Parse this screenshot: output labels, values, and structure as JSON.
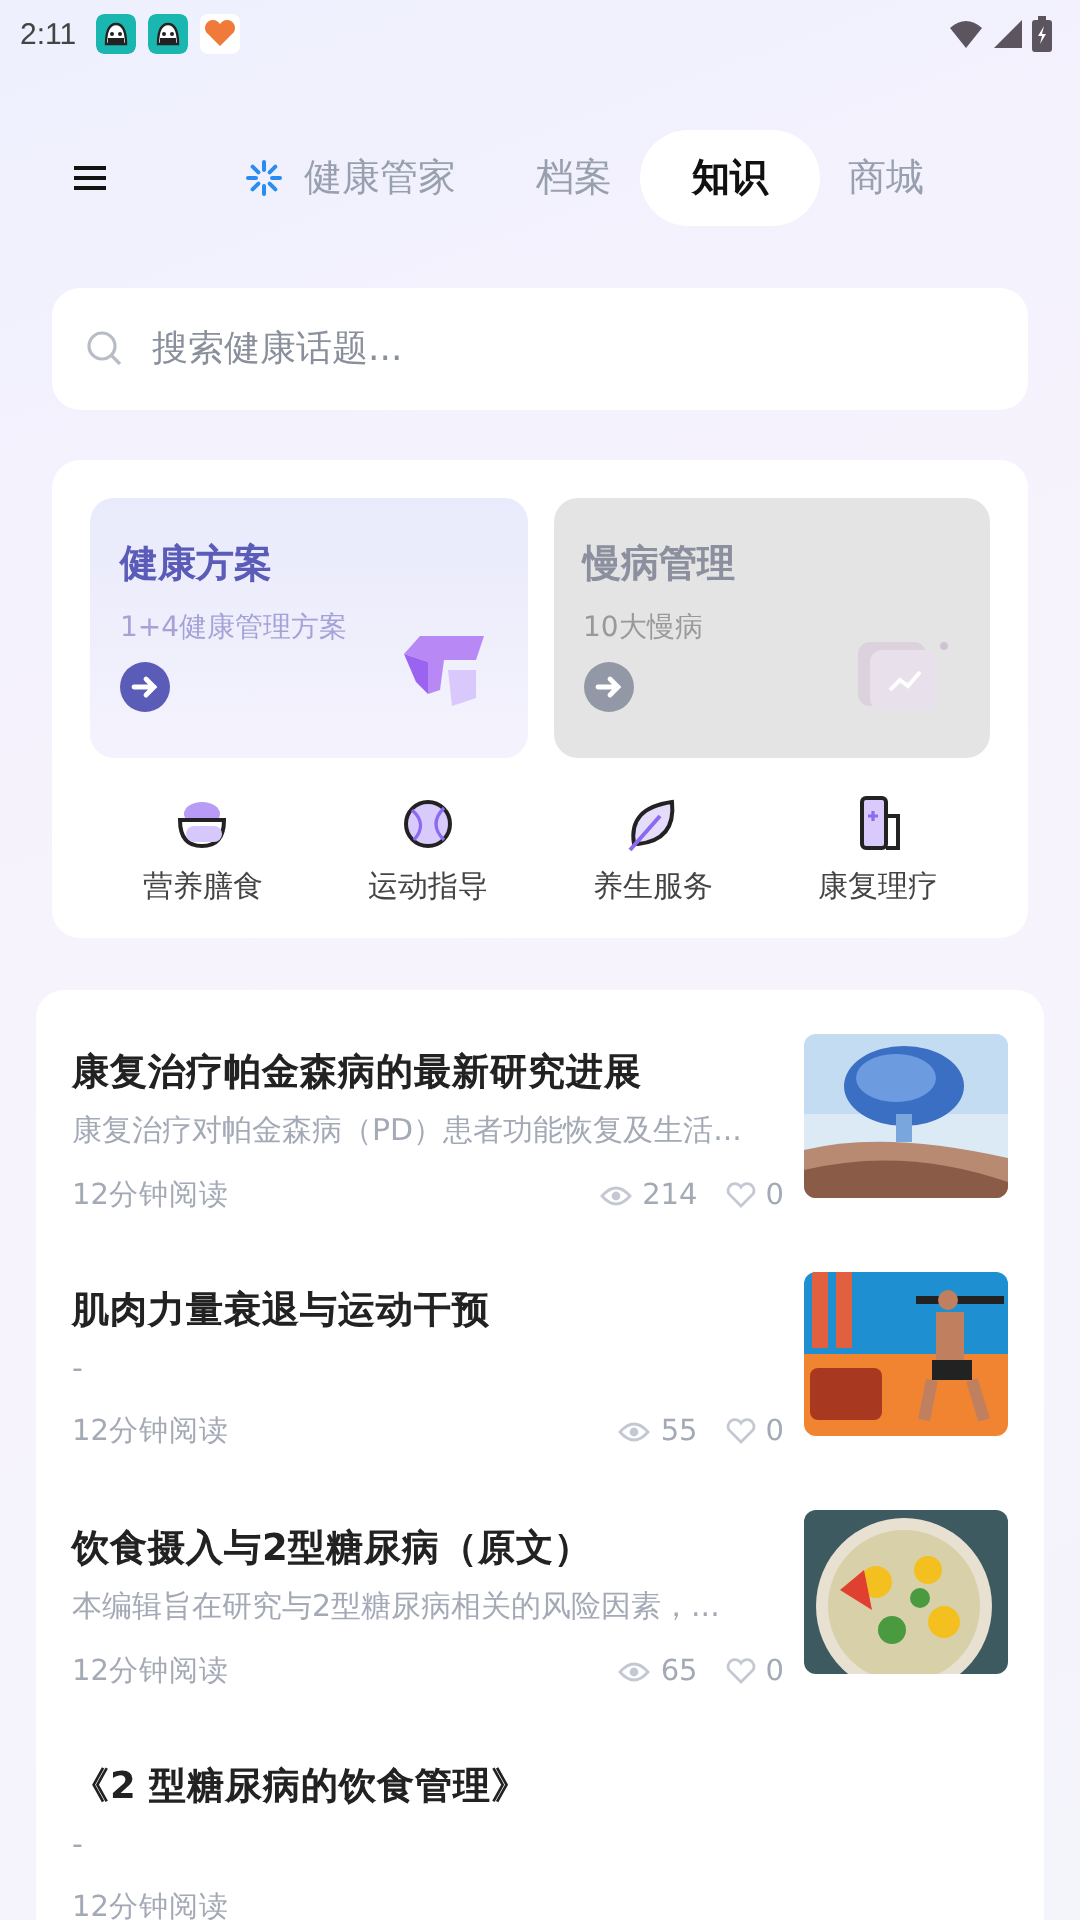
{
  "status_bar": {
    "time": "2:11",
    "app_icons": [
      {
        "kind": "robot"
      },
      {
        "kind": "robot"
      },
      {
        "kind": "heart"
      }
    ]
  },
  "nav": {
    "tabs": [
      {
        "label": "健康管家",
        "selected": false,
        "kind": "spinner"
      },
      {
        "label": "档案",
        "selected": false
      },
      {
        "label": "知识",
        "selected": true
      },
      {
        "label": "商城",
        "selected": false
      }
    ]
  },
  "search": {
    "placeholder": "搜索健康话题..."
  },
  "feature_cards": [
    {
      "title": "健康方案",
      "subtitle": "1+4健康管理方案",
      "kind": "plan"
    },
    {
      "title": "慢病管理",
      "subtitle": "10大慢病",
      "kind": "chronic"
    }
  ],
  "shortcuts": [
    {
      "label": "营养膳食",
      "kind": "bowl"
    },
    {
      "label": "运动指导",
      "kind": "ball"
    },
    {
      "label": "养生服务",
      "kind": "leaf"
    },
    {
      "label": "康复理疗",
      "kind": "device"
    }
  ],
  "articles": [
    {
      "title": "康复治疗帕金森病的最新研究进展",
      "summary": "康复治疗对帕金森病（PD）患者功能恢复及生活...",
      "read_time": "12分钟阅读",
      "views": "214",
      "likes": "0"
    },
    {
      "title": "肌肉力量衰退与运动干预",
      "summary": "-",
      "read_time": "12分钟阅读",
      "views": "55",
      "likes": "0"
    },
    {
      "title": "饮食摄入与2型糖尿病（原文）",
      "summary": "本编辑旨在研究与2型糖尿病相关的风险因素，...",
      "read_time": "12分钟阅读",
      "views": "65",
      "likes": "0"
    },
    {
      "title": "《2 型糖尿病的饮食管理》",
      "summary": "-",
      "read_time": "12分钟阅读"
    }
  ]
}
